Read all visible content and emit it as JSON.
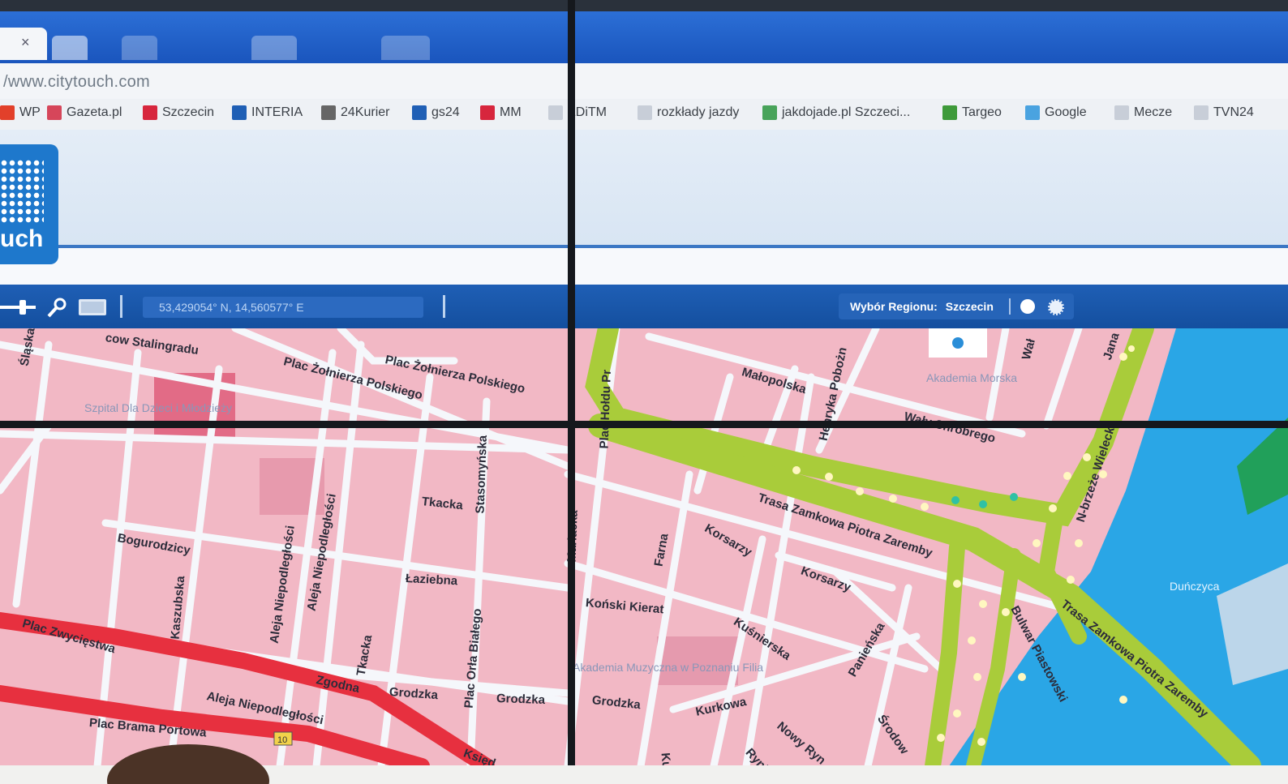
{
  "browser": {
    "tab_close": "×",
    "url": "/www.citytouch.com",
    "bookmarks": [
      {
        "label": "WP",
        "icon": "wp-icon",
        "color": "#e2402a"
      },
      {
        "label": "Gazeta.pl",
        "icon": "gazeta-icon",
        "color": "#d6465a"
      },
      {
        "label": "Szczecin",
        "icon": "szczecin-icon",
        "color": "#d7263d"
      },
      {
        "label": "INTERIA",
        "icon": "interia-icon",
        "color": "#1f5fb5"
      },
      {
        "label": "24Kurier",
        "icon": "kurier-icon",
        "color": "#666666"
      },
      {
        "label": "gs24",
        "icon": "gs24-icon",
        "color": "#1f5fb5"
      },
      {
        "label": "MM",
        "icon": "mm-icon",
        "color": "#d7263d"
      },
      {
        "label": "ZDiTM",
        "icon": "page-icon",
        "color": "#c8ced8"
      },
      {
        "label": "rozkłady jazdy",
        "icon": "page-icon",
        "color": "#c8ced8"
      },
      {
        "label": "jakdojade.pl Szczeci...",
        "icon": "jakdojade-icon",
        "color": "#48a35a"
      },
      {
        "label": "Targeo",
        "icon": "targeo-icon",
        "color": "#3e9a3a"
      },
      {
        "label": "Google",
        "icon": "google-icon",
        "color": "#4aa3e0"
      },
      {
        "label": "Mecze",
        "icon": "page-icon",
        "color": "#c8ced8"
      },
      {
        "label": "TVN24",
        "icon": "page-icon",
        "color": "#c8ced8"
      }
    ]
  },
  "app": {
    "logo_text": "uch",
    "toolbar": {
      "coordinates": "53,429054° N, 14,560577° E",
      "region_label": "Wybór Regionu:",
      "region_value": "Szczecin",
      "tools": [
        "pan-slider-icon",
        "zoom-icon",
        "layer-icon"
      ]
    }
  },
  "map": {
    "streets": [
      "cow Stalingradu",
      "Śląska",
      "Plac Żołnierza Polskiego",
      "Plac Żołnierza Polskiego",
      "Plac Hołdu Pr",
      "Małopolska",
      "Henryka Pobożn",
      "Wały Chrobrego",
      "Wał",
      "Jana",
      "Tkacka",
      "Stasomyńska",
      "Bogurodzicy",
      "Aleja Niepodległości",
      "Aleja Niepodległości",
      "Łaziebna",
      "Kaszubska",
      "Plac Zwycięstwa",
      "Tkacka",
      "Plac Orła Białego",
      "Zgodna",
      "Grodzka",
      "Grodzka",
      "Aleja Niepodległości",
      "Plac Brama Portowa",
      "Księd",
      "Trasa Zamkowa Piotra Zaremby",
      "Farna",
      "Mariacka",
      "Korsarzy",
      "Korsarzy",
      "Koński Kierat",
      "Kuśnierska",
      "Panieńska",
      "Grodzka",
      "Kurkowa",
      "Nowy Ryn",
      "Rynk",
      "Kur",
      "Bulwar Piastowski",
      "Trasa Zamkowa Piotra Zaremby",
      "N-brzeże Wieleck",
      "Środow"
    ],
    "pois": [
      "Szpital Dla Dzieci i Młodzieży",
      "Akademia Morska",
      "Akademia Muzyczna w Poznaniu Filia",
      "Duńczyca"
    ],
    "road_number": "10",
    "colors": {
      "land": "#f2b8c5",
      "street": "#f5f7fb",
      "highway": "#a9cc3a",
      "water": "#2aa6e6",
      "main_road": "#e7303f"
    }
  }
}
